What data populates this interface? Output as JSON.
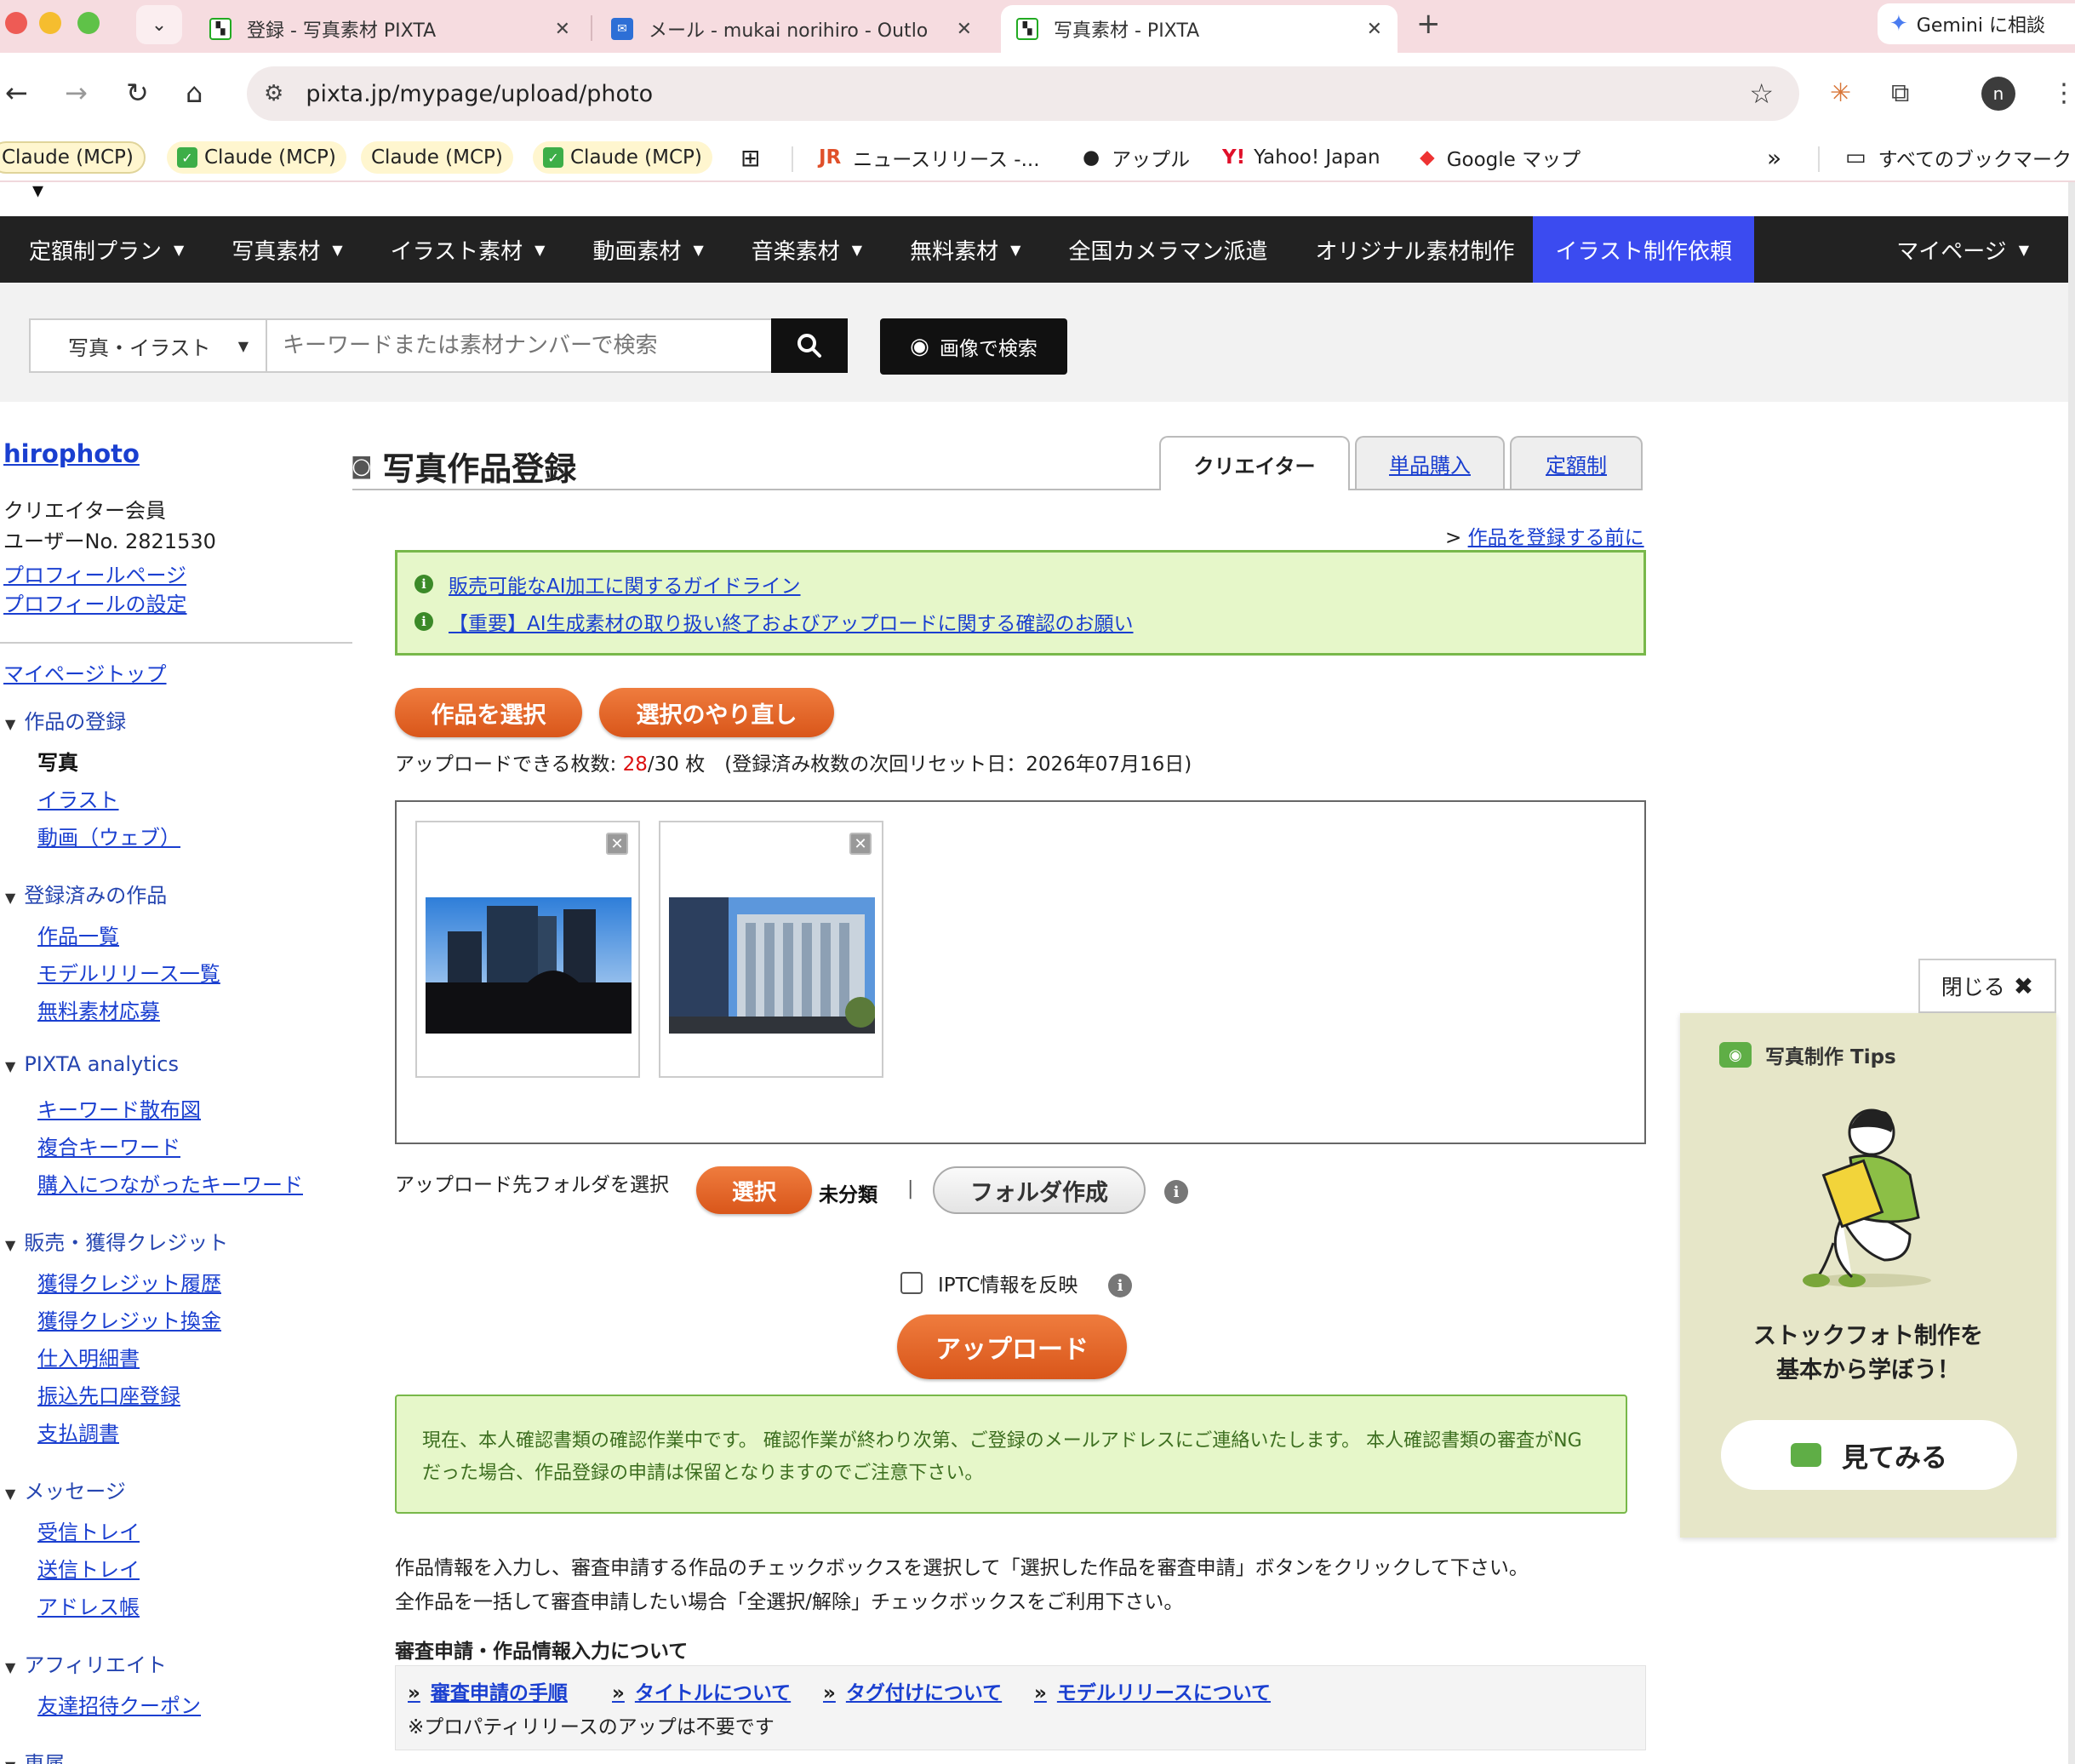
{
  "browser": {
    "tabs": [
      {
        "title": "登録 - 写真素材 PIXTA",
        "active": false
      },
      {
        "title": "メール - mukai norihiro - Outlo",
        "active": false
      },
      {
        "title": "写真素材 - PIXTA",
        "active": true
      }
    ],
    "gemini_label": "Gemini に相談",
    "url": "pixta.jp/mypage/upload/photo",
    "profile_initial": "n",
    "bookmarks": [
      {
        "label": "Claude (MCP)",
        "check": false
      },
      {
        "label": "Claude (MCP)",
        "check": true
      },
      {
        "label": "Claude (MCP)",
        "check": false
      },
      {
        "label": "Claude (MCP)",
        "check": true
      },
      {
        "label": "ニュースリリース -...",
        "check": false
      },
      {
        "label": "アップル",
        "check": false
      },
      {
        "label": "Yahoo! Japan",
        "check": false
      },
      {
        "label": "Google マップ",
        "check": false
      }
    ],
    "all_bookmarks": "すべてのブックマーク"
  },
  "nav": {
    "items": [
      "定額制プラン",
      "写真素材",
      "イラスト素材",
      "動画素材",
      "音楽素材",
      "無料素材",
      "全国カメラマン派遣",
      "オリジナル素材制作",
      "イラスト制作依頼"
    ],
    "mypage": "マイページ",
    "highlight_color": "#3b4bf0"
  },
  "search": {
    "category": "写真・イラスト",
    "placeholder": "キーワードまたは素材ナンバーで検索",
    "image_search": "画像で検索"
  },
  "sidebar": {
    "username": "hirophoto",
    "member_type": "クリエイター会員",
    "user_no": "ユーザーNo. 2821530",
    "profile_page": "プロフィールページ",
    "profile_settings": "プロフィールの設定",
    "mypage_top": "マイページトップ",
    "sections": [
      {
        "title": "作品の登録",
        "items": [
          "写真",
          "イラスト",
          "動画（ウェブ）"
        ]
      },
      {
        "title": "登録済みの作品",
        "items": [
          "作品一覧",
          "モデルリリース一覧",
          "無料素材応募"
        ]
      },
      {
        "title": "PIXTA analytics",
        "items": [
          "キーワード散布図",
          "複合キーワード",
          "購入につながったキーワード"
        ]
      },
      {
        "title": "販売・獲得クレジット",
        "items": [
          "獲得クレジット履歴",
          "獲得クレジット換金",
          "仕入明細書",
          "振込先口座登録",
          "支払調書"
        ]
      },
      {
        "title": "メッセージ",
        "items": [
          "受信トレイ",
          "送信トレイ",
          "アドレス帳"
        ]
      },
      {
        "title": "アフィリエイト",
        "items": [
          "友達招待クーポン"
        ]
      },
      {
        "title": "専属",
        "items": []
      }
    ]
  },
  "main": {
    "title": "写真作品登録",
    "role_tabs": [
      "クリエイター",
      "単品購入",
      "定額制"
    ],
    "before_register": "作品を登録する前に",
    "info_links": [
      "販売可能なAI加工に関するガイドライン",
      "【重要】AI生成素材の取り扱い終了およびアップロードに関する確認のお願い"
    ],
    "select_button": "作品を選択",
    "reset_button": "選択のやり直し",
    "quota_prefix": "アップロードできる枚数: ",
    "quota_used": "28",
    "quota_rest": "/30 枚　(登録済み枚数の次回リセット日：2026年07月16日)",
    "folder_label": "アップロード先フォルダを選択",
    "folder_select": "選択",
    "folder_status": "未分類",
    "folder_sep": "|",
    "folder_create": "フォルダ作成",
    "iptc_label": "IPTC情報を反映",
    "upload_button": "アップロード",
    "notice": "現在、本人確認書類の確認作業中です。 確認作業が終わり次第、ご登録のメールアドレスにご連絡いたします。 本人確認書類の審査がNGだった場合、作品登録の申請は保留となりますのでご注意下さい。",
    "instruction_1": "作品情報を入力し、審査申請する作品のチェックボックスを選択して「選択した作品を審査申請」ボタンをクリックして下さい。",
    "instruction_2": "全作品を一括して審査申請したい場合「全選択/解除」チェックボックスをご利用下さい。",
    "review_heading": "審査申請・作品情報入力について",
    "review_links": [
      "審査申請の手順",
      "タイトルについて",
      "タグ付けについて",
      "モデルリリースについて"
    ],
    "review_note": "※プロパティリリースのアップは不要です"
  },
  "tips": {
    "close": "閉じる",
    "title": "写真制作 Tips",
    "headline_1": "ストックフォト制作を",
    "headline_2": "基本から学ぼう！",
    "button": "見てみる",
    "accent": "#5fae46"
  }
}
